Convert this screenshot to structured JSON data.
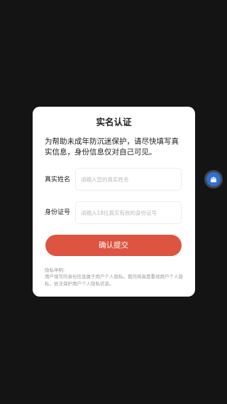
{
  "dialog": {
    "title": "实名认证",
    "description": "为帮助未成年防沉迷保护，请尽快填写真实信息，身份信息仅对自己可见。",
    "name_label": "真实姓名",
    "name_placeholder": "请输入您的真实姓名",
    "id_label": "身份证号",
    "id_placeholder": "请输入18位真实有效的身份证号",
    "submit_label": "确认提交",
    "privacy_title": "隐私申明:",
    "privacy_text": "用户填写的身份信息属于用户个人隐私。我司将高度重视用户个人隐私，依法保护用户个人隐私信息。"
  },
  "floating_button": {
    "icon": "android-icon",
    "color": "#2f6fd6"
  },
  "colors": {
    "background": "#141414",
    "dialog": "#ffffff",
    "accent": "#dd5441"
  }
}
